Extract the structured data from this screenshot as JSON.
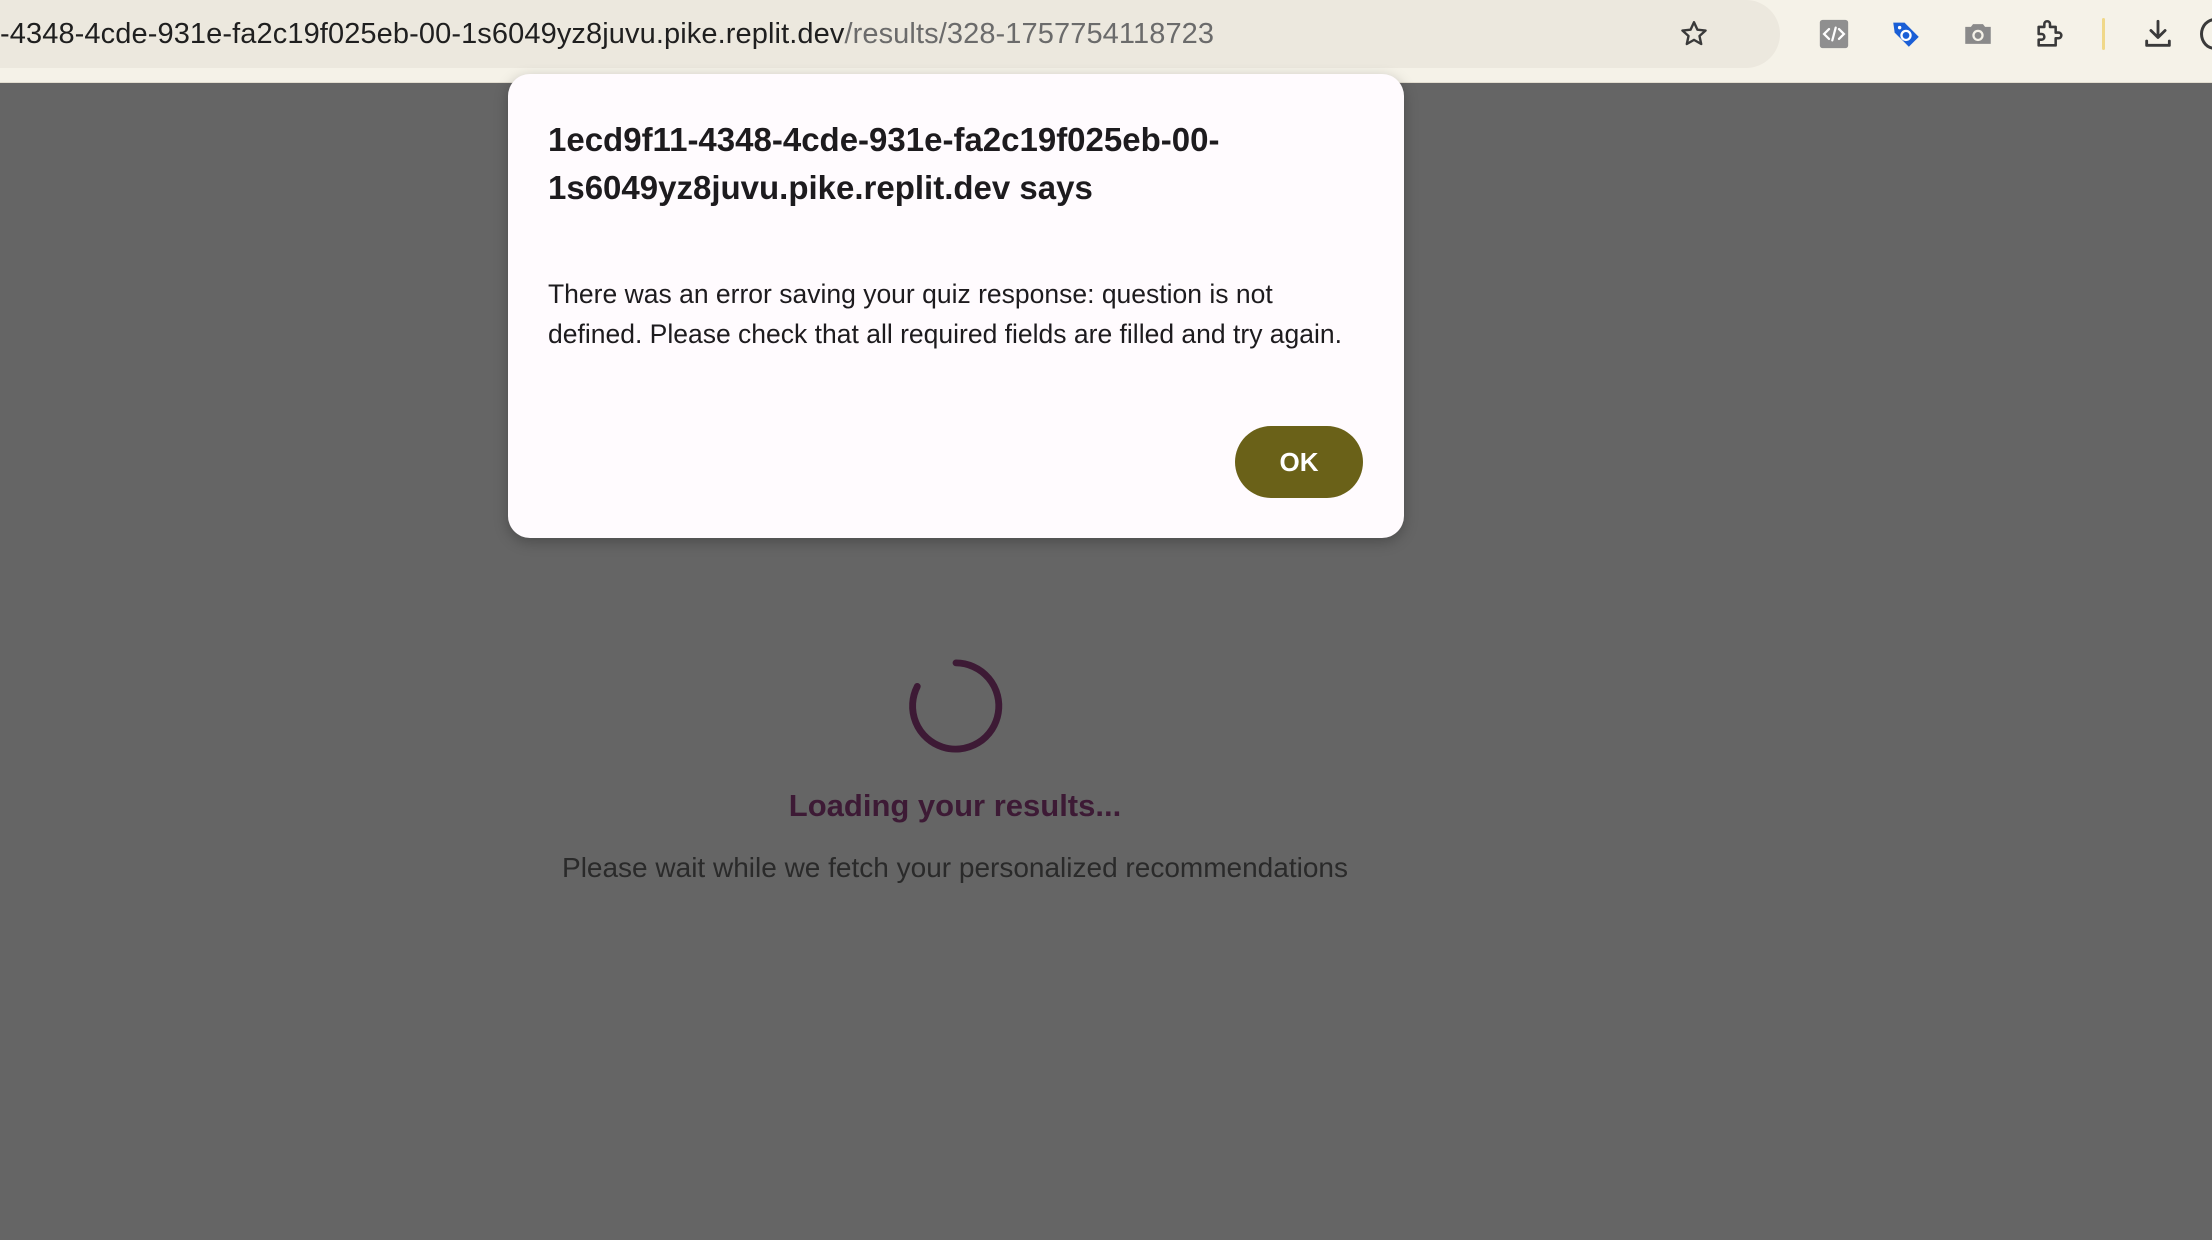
{
  "browser": {
    "url_host": "-4348-4cde-931e-fa2c19f025eb-00-1s6049yz8juvu.pike.replit.dev",
    "url_path": "/results/328-1757754118723",
    "toolbar_icons": [
      "bookmark-star-icon",
      "code-extension-icon",
      "tag-extension-icon",
      "camera-icon",
      "extensions-puzzle-icon",
      "download-icon"
    ]
  },
  "dialog": {
    "title": "1ecd9f11-4348-4cde-931e-fa2c19f025eb-00-1s6049yz8juvu.pike.replit.dev says",
    "message": "There was an error saving your quiz response: question is not defined. Please check that all required fields are filled and try again.",
    "ok_label": "OK"
  },
  "page": {
    "loading_title": "Loading your results...",
    "loading_subtitle": "Please wait while we fetch your personalized recommendations"
  },
  "colors": {
    "overlay_background": "#656565",
    "ok_button": "#6a6118",
    "spinner": "#3d1a35",
    "loading_title": "#3d1a35"
  }
}
